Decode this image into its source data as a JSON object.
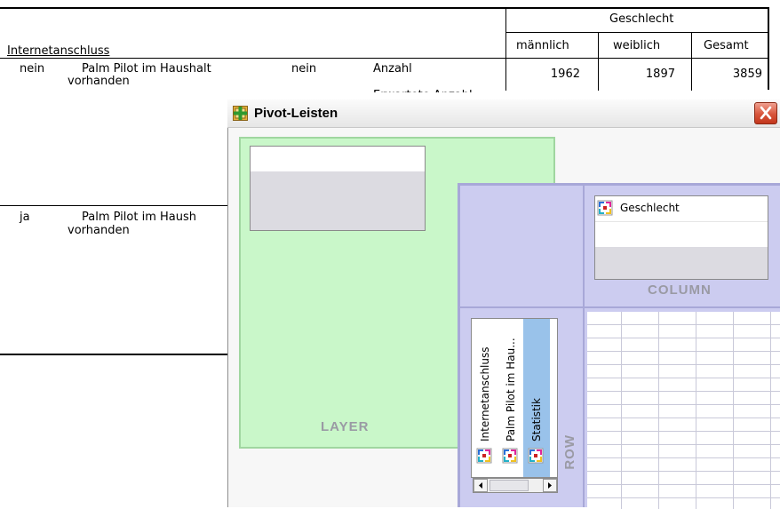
{
  "table": {
    "header_group": "Geschlecht",
    "row_dim_label": "Internetanschluss",
    "columns": [
      "männlich",
      "weiblich",
      "Gesamt"
    ],
    "rows": [
      {
        "internet": "nein",
        "palm_label_l1": "Palm Pilot im Haushalt",
        "palm_label_l2": "vorhanden",
        "palm_value": "nein",
        "stat": "Anzahl",
        "stat_partial": "Erwartete Anzahl",
        "values": [
          "1962",
          "1897",
          "3859"
        ]
      },
      {
        "internet": "ja",
        "palm_label_l1": "Palm Pilot im Haush",
        "palm_label_l2": "vorhanden"
      }
    ]
  },
  "dialog": {
    "title": "Pivot-Leisten",
    "layer_label": "LAYER",
    "column_label": "COLUMN",
    "row_label": "ROW",
    "column_items": [
      "Geschlecht"
    ],
    "row_items": [
      "Internetanschluss",
      "Palm Pilot im Hau...",
      "Statistik"
    ]
  }
}
